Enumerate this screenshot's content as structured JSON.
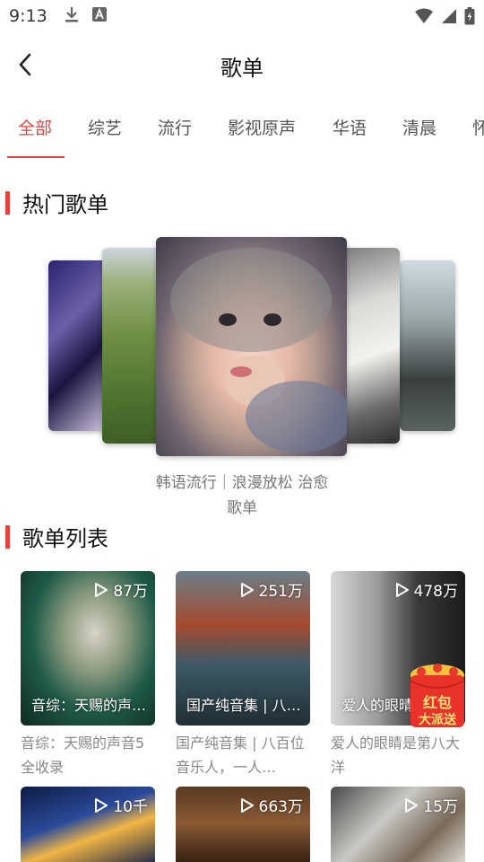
{
  "status_bar": {
    "time": "9:13"
  },
  "header": {
    "title": "歌单"
  },
  "tabs": [
    {
      "label": "全部",
      "active": true
    },
    {
      "label": "综艺",
      "active": false
    },
    {
      "label": "流行",
      "active": false
    },
    {
      "label": "影视原声",
      "active": false
    },
    {
      "label": "华语",
      "active": false
    },
    {
      "label": "清晨",
      "active": false
    },
    {
      "label": "怀",
      "active": false
    }
  ],
  "hot_section": {
    "title": "热门歌单"
  },
  "carousel": {
    "caption_line1": "韩语流行｜浪漫放松 治愈",
    "caption_line2": "歌单"
  },
  "list_section": {
    "title": "歌单列表"
  },
  "playlists": [
    {
      "play_count": "87万",
      "thumb_title": "音综：天赐的声…",
      "desc": "音综：天赐的声音5全收录"
    },
    {
      "play_count": "251万",
      "thumb_title": "国产纯音集 | 八…",
      "desc": "国产纯音集 | 八百位音乐人，一人…"
    },
    {
      "play_count": "478万",
      "thumb_title": "爱人的眼晴",
      "desc": "爱人的眼睛是第八大洋"
    },
    {
      "play_count": "10千",
      "thumb_title": "",
      "desc": ""
    },
    {
      "play_count": "663万",
      "thumb_title": "",
      "desc": ""
    },
    {
      "play_count": "15万",
      "thumb_title": "",
      "desc": ""
    }
  ],
  "promo": {
    "line1": "红包",
    "line2": "大派送"
  },
  "colors": {
    "accent": "#e8413c"
  }
}
